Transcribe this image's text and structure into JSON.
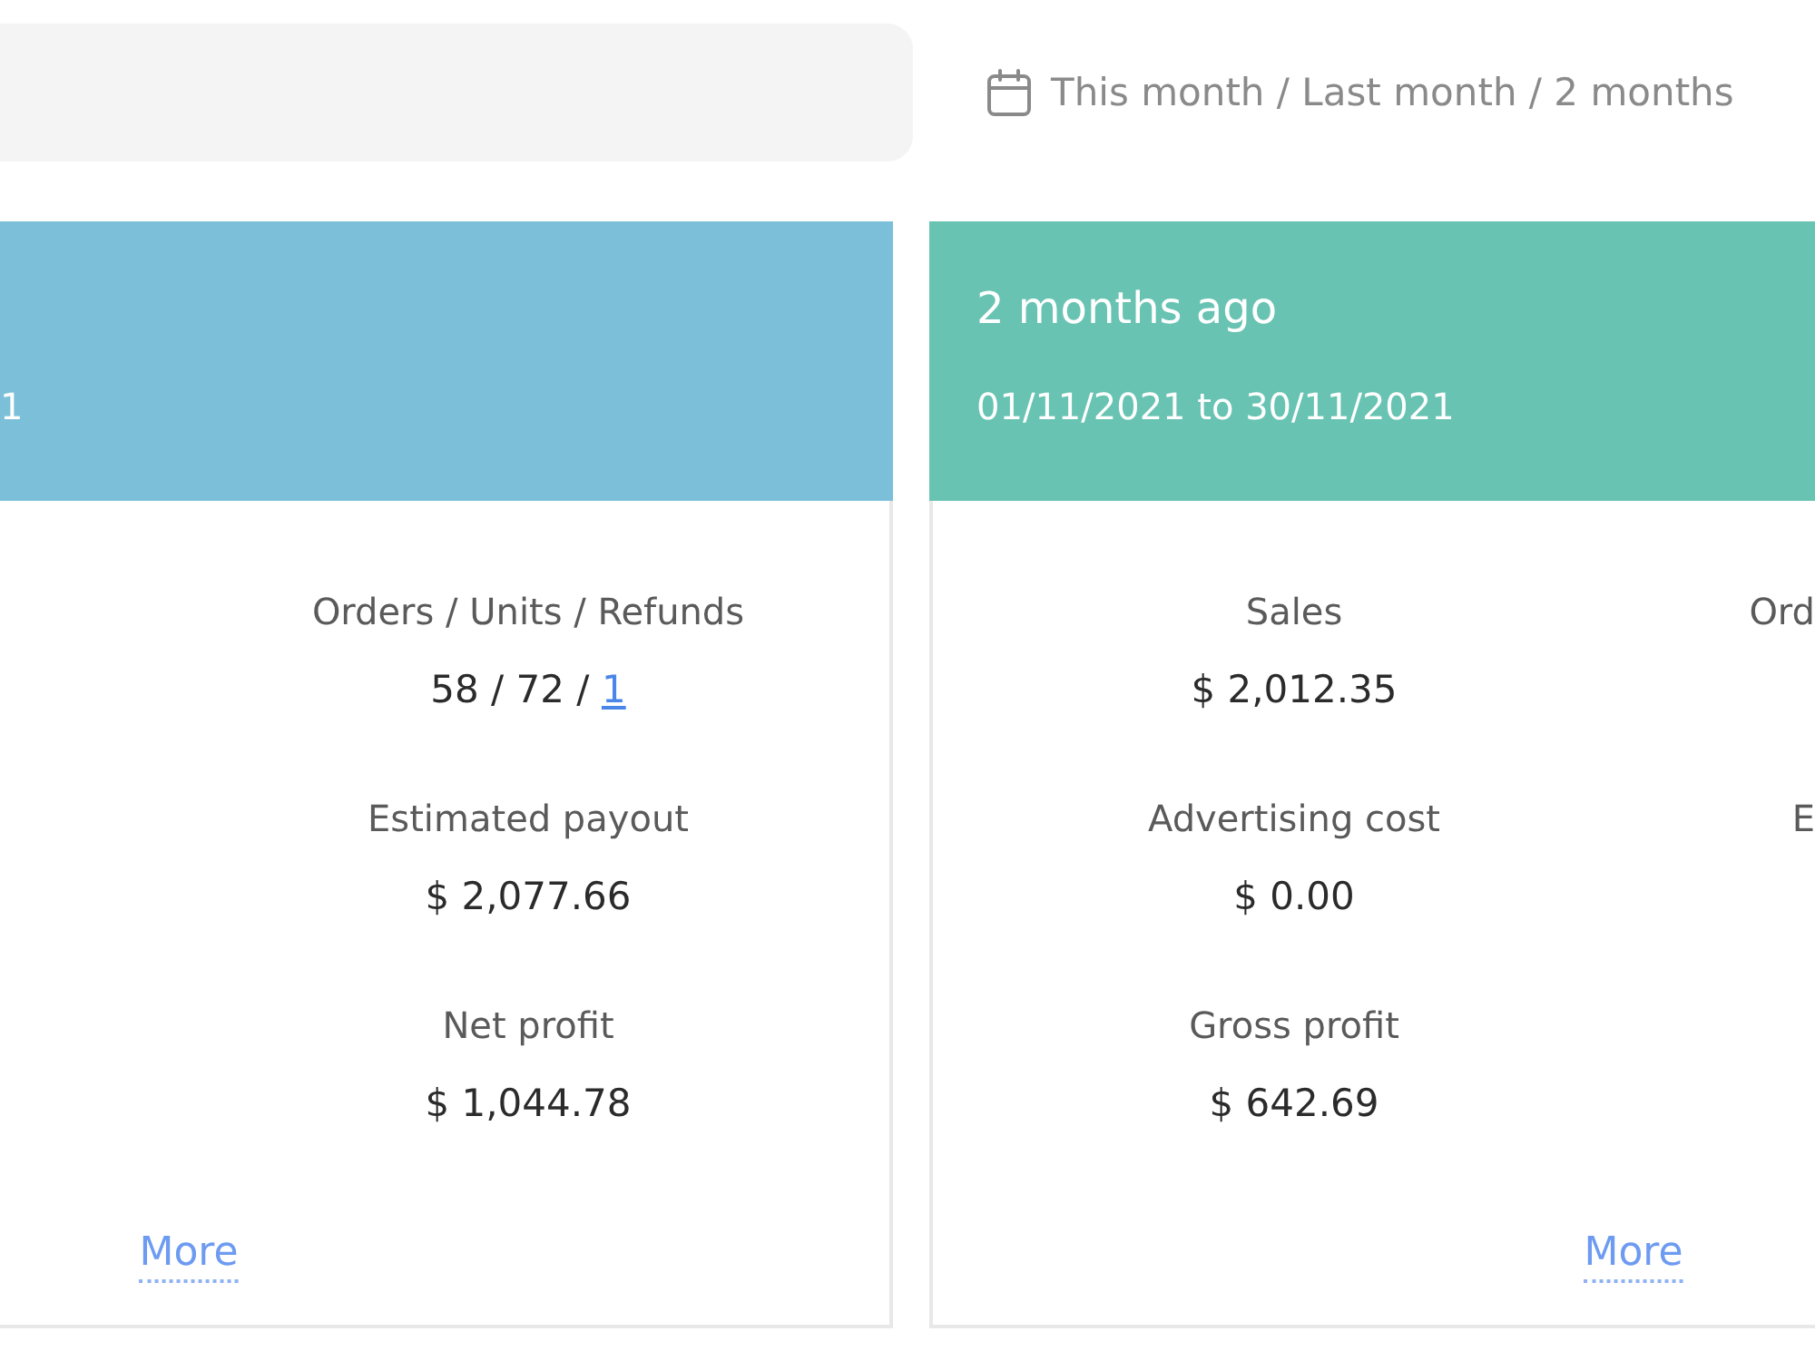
{
  "date_range": {
    "text": "This month / Last month / 2 months"
  },
  "cards": [
    {
      "color": "#7bbfd9",
      "date_range": "1",
      "column_2": [
        {
          "label": "Orders / Units / Refunds",
          "value": "58 / 72 /",
          "value_link": "1"
        },
        {
          "label": "Estimated payout",
          "value": "$ 2,077.66"
        },
        {
          "label": "Net profit",
          "value": "$ 1,044.78"
        }
      ],
      "more_link": "More"
    },
    {
      "color": "#68c3b3",
      "title": "2 months ago",
      "date_range": "01/11/2021 to 30/11/2021",
      "column_1": [
        {
          "label": "Sales",
          "value": "$ 2,012.35"
        },
        {
          "label": "Advertising cost",
          "value": "$ 0.00"
        },
        {
          "label": "Gross profit",
          "value": "$ 642.69"
        }
      ],
      "column_2": [
        {
          "label": "Ord"
        },
        {
          "label": "E"
        }
      ],
      "more_link": "More"
    }
  ]
}
